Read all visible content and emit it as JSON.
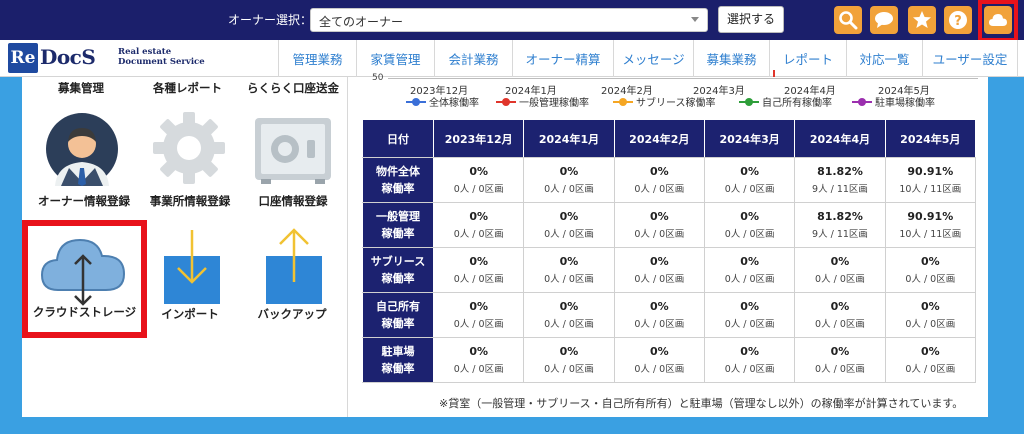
{
  "topbar": {
    "owner_label": "オーナー選択：",
    "owner_select_value": "全てのオーナー",
    "select_button": "選択する",
    "icons": [
      "search-icon",
      "chat-icon",
      "star-icon",
      "help-icon",
      "cloud-icon"
    ],
    "accent_color": "#f1a23a",
    "bg_color": "#1b1f6b",
    "highlight_color": "#e8121b"
  },
  "logo": {
    "mark": "Re",
    "rest": "DocS",
    "sub_line1": "Real estate",
    "sub_line2": "Document Service"
  },
  "nav": {
    "items": [
      "管理業務",
      "家賃管理",
      "会計業務",
      "オーナー精算",
      "メッセージ",
      "募集業務",
      "レポート",
      "対応一覧",
      "ユーザー設定"
    ]
  },
  "left": {
    "categories": [
      "募集管理",
      "各種レポート",
      "らくらく口座送金"
    ],
    "tiles": {
      "owner_registration": "オーナー情報登録",
      "office_registration": "事業所情報登録",
      "account_registration": "口座情報登録",
      "cloud_storage": "クラウドストレージ",
      "import": "インポート",
      "backup": "バックアップ"
    }
  },
  "legend": {
    "tick": "50",
    "months": [
      "2023年12月",
      "2024年1月",
      "2024年2月",
      "2024年3月",
      "2024年4月",
      "2024年5月"
    ],
    "series": [
      {
        "name": "全体稼働率",
        "color": "#3a6fd8"
      },
      {
        "name": "一般管理稼働率",
        "color": "#e0352b"
      },
      {
        "name": "サブリース稼働率",
        "color": "#f5a623"
      },
      {
        "name": "自己所有稼働率",
        "color": "#2e9e3a"
      },
      {
        "name": "駐車場稼働率",
        "color": "#9b2fae"
      }
    ]
  },
  "table": {
    "header_first": "日付",
    "columns": [
      "2023年12月",
      "2024年1月",
      "2024年2月",
      "2024年3月",
      "2024年4月",
      "2024年5月"
    ],
    "rows": [
      {
        "line1": "物件全体",
        "line2": "稼働率",
        "cells": [
          [
            "0%",
            "0人 / 0区画"
          ],
          [
            "0%",
            "0人 / 0区画"
          ],
          [
            "0%",
            "0人 / 0区画"
          ],
          [
            "0%",
            "0人 / 0区画"
          ],
          [
            "81.82%",
            "9人 / 11区画"
          ],
          [
            "90.91%",
            "10人 / 11区画"
          ]
        ]
      },
      {
        "line1": "一般管理",
        "line2": "稼働率",
        "cells": [
          [
            "0%",
            "0人 / 0区画"
          ],
          [
            "0%",
            "0人 / 0区画"
          ],
          [
            "0%",
            "0人 / 0区画"
          ],
          [
            "0%",
            "0人 / 0区画"
          ],
          [
            "81.82%",
            "9人 / 11区画"
          ],
          [
            "90.91%",
            "10人 / 11区画"
          ]
        ]
      },
      {
        "line1": "サブリース",
        "line2": "稼働率",
        "cells": [
          [
            "0%",
            "0人 / 0区画"
          ],
          [
            "0%",
            "0人 / 0区画"
          ],
          [
            "0%",
            "0人 / 0区画"
          ],
          [
            "0%",
            "0人 / 0区画"
          ],
          [
            "0%",
            "0人 / 0区画"
          ],
          [
            "0%",
            "0人 / 0区画"
          ]
        ]
      },
      {
        "line1": "自己所有",
        "line2": "稼働率",
        "cells": [
          [
            "0%",
            "0人 / 0区画"
          ],
          [
            "0%",
            "0人 / 0区画"
          ],
          [
            "0%",
            "0人 / 0区画"
          ],
          [
            "0%",
            "0人 / 0区画"
          ],
          [
            "0%",
            "0人 / 0区画"
          ],
          [
            "0%",
            "0人 / 0区画"
          ]
        ]
      },
      {
        "line1": "駐車場",
        "line2": "稼働率",
        "cells": [
          [
            "0%",
            "0人 / 0区画"
          ],
          [
            "0%",
            "0人 / 0区画"
          ],
          [
            "0%",
            "0人 / 0区画"
          ],
          [
            "0%",
            "0人 / 0区画"
          ],
          [
            "0%",
            "0人 / 0区画"
          ],
          [
            "0%",
            "0人 / 0区画"
          ]
        ]
      }
    ]
  },
  "footnote": "※貸室（一般管理・サブリース・自己所有所有）と駐車場（管理なし以外）の稼働率が計算されています。"
}
